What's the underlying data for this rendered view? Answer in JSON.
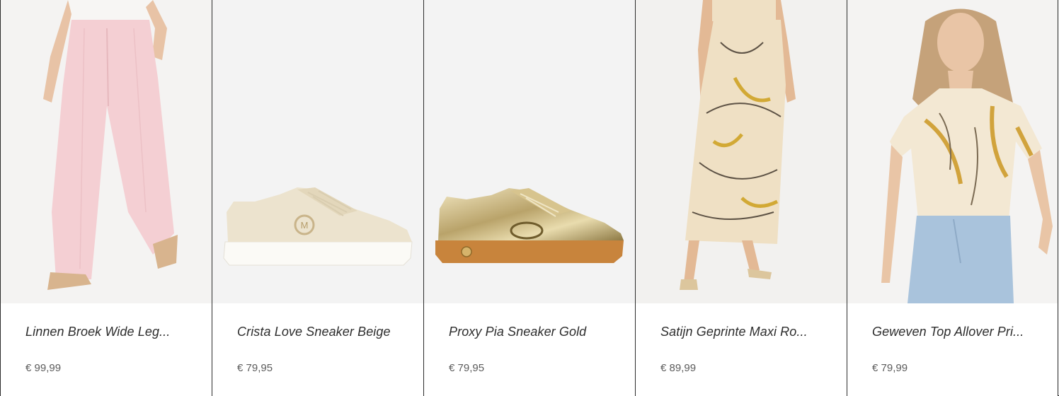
{
  "products": [
    {
      "title": "Linnen Broek Wide Leg...",
      "price": "€ 99,99",
      "image": "pink-wide-leg-trousers"
    },
    {
      "title": "Crista Love Sneaker Beige",
      "price": "€ 79,95",
      "image": "beige-sneaker"
    },
    {
      "title": "Proxy Pia Sneaker Gold",
      "price": "€ 79,95",
      "image": "gold-sneaker"
    },
    {
      "title": "Satijn Geprinte Maxi Ro...",
      "price": "€ 89,99",
      "image": "printed-satin-maxi-skirt"
    },
    {
      "title": "Geweven Top Allover Pri...",
      "price": "€ 79,99",
      "image": "printed-woven-top"
    }
  ]
}
